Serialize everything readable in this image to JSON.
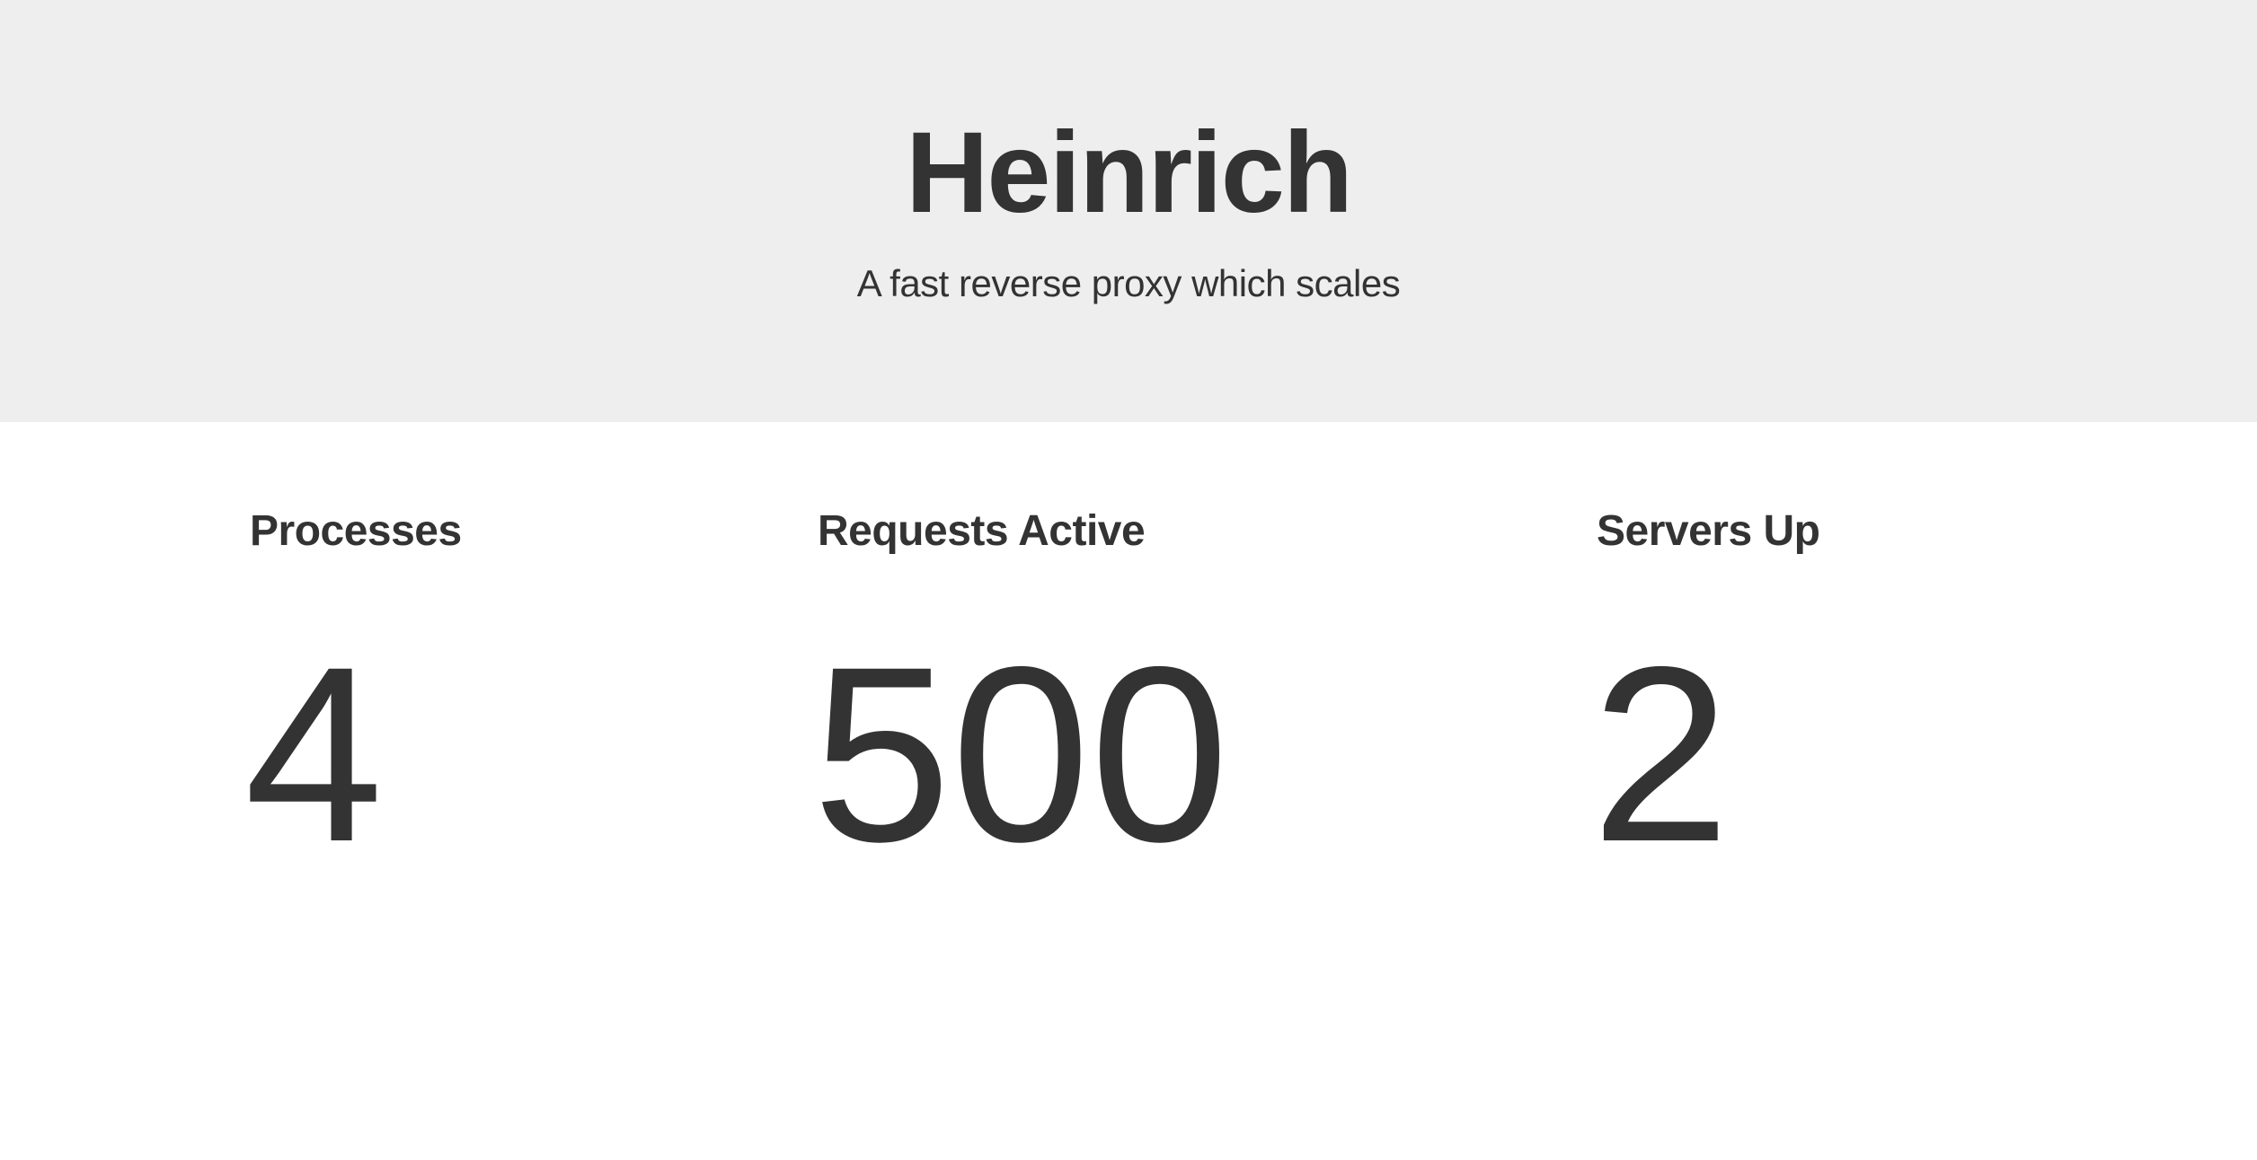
{
  "header": {
    "title": "Heinrich",
    "subtitle": "A fast reverse proxy which scales"
  },
  "stats": [
    {
      "label": "Processes",
      "value": "4"
    },
    {
      "label": "Requests Active",
      "value": "500"
    },
    {
      "label": "Servers Up",
      "value": "2"
    }
  ],
  "colors": {
    "header_background": "#eeeeee",
    "page_background": "#ffffff",
    "text": "#333333"
  }
}
